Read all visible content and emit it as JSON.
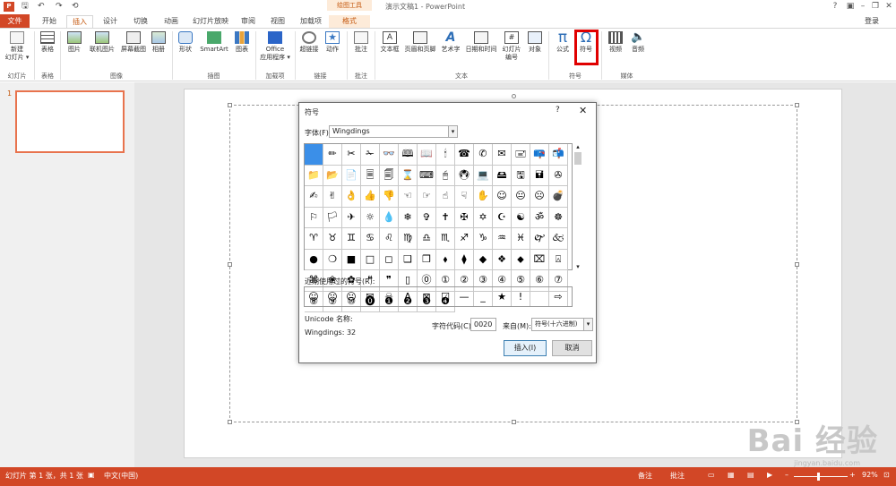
{
  "window": {
    "title": "演示文稿1 - PowerPoint",
    "contextual_tools": "绘图工具",
    "qat": [
      "↶",
      "↷",
      "⟲"
    ],
    "app_icon_label": "P",
    "login": "登录"
  },
  "tabs": [
    "文件",
    "开始",
    "插入",
    "设计",
    "切换",
    "动画",
    "幻灯片放映",
    "审阅",
    "视图",
    "加载项",
    "格式"
  ],
  "ribbon": {
    "groups": {
      "slides": "幻灯片",
      "tables": "表格",
      "images": "图像",
      "illustrations": "插图",
      "addins": "加载项",
      "links": "链接",
      "comments": "批注",
      "text": "文本",
      "symbols": "符号",
      "media": "媒体"
    },
    "buttons": {
      "new_slide": "新建\n幻灯片 ▾",
      "table": "表格",
      "picture": "图片",
      "online_picture": "联机图片",
      "screenshot": "屏幕截图",
      "album": "相册",
      "shapes": "形状",
      "smartart": "SmartArt",
      "chart": "图表",
      "office_apps": "Office\n应用程序 ▾",
      "hyperlink": "超链接",
      "action": "动作",
      "comment": "批注",
      "textbox": "文本框",
      "header_footer": "页眉和页脚",
      "wordart": "艺术字",
      "datetime": "日期和时间",
      "slide_number": "幻灯片\n编号",
      "object": "对象",
      "equation": "公式",
      "symbol": "符号",
      "video": "视频",
      "audio": "音频"
    }
  },
  "thumbnails": {
    "slide_number": "1"
  },
  "watermark": {
    "text": "Bai 经验",
    "url": "jingyan.baidu.com"
  },
  "statusbar": {
    "slide_info": "幻灯片 第 1 张，共 1 张",
    "language": "中文(中国)",
    "notes": "备注",
    "comments": "批注",
    "zoom": "92%"
  },
  "dialog": {
    "title": "符号",
    "help": "?",
    "close": "✕",
    "font_label": "字体(F):",
    "font_value": "Wingdings",
    "symbols": [
      " ",
      "✏",
      "✂",
      "✁",
      "👓",
      "🕮",
      "📖",
      "🕯",
      "☎",
      "✆",
      "✉",
      "🖃",
      "📪",
      "📬",
      "📁",
      "📂",
      "📄",
      "🗏",
      "🗐",
      "⌛",
      "⌨",
      "🖰",
      "🖲",
      "💻",
      "🖴",
      "🖫",
      "🖬",
      "✇",
      "✍",
      "✌",
      "👌",
      "👍",
      "👎",
      "☜",
      "☞",
      "☝",
      "☟",
      "✋",
      "☺",
      "😐",
      "☹",
      "💣",
      "⚐",
      "🏳",
      "✈",
      "☼",
      "💧",
      "❄",
      "✞",
      "✝",
      "✠",
      "✡",
      "☪",
      "☯",
      "ॐ",
      "☸",
      "♈",
      "♉",
      "♊",
      "♋",
      "♌",
      "♍",
      "♎",
      "♏",
      "♐",
      "♑",
      "♒",
      "♓",
      "🙰",
      "🙵",
      "●",
      "❍",
      "■",
      "□",
      "◻",
      "❑",
      "❒",
      "⬧",
      "⧫",
      "◆",
      "❖",
      "⬥",
      "⌧",
      "⍓",
      "⌘",
      "❀",
      "✿",
      "❝",
      "❞",
      "▯",
      "⓪",
      "①",
      "②",
      "③",
      "④",
      "⑤",
      "⑥",
      "⑦",
      "⑧",
      "⑨",
      "⑩",
      "⓿",
      "❶",
      "❷",
      "❸",
      "❹"
    ],
    "recent_label": "近期使用过的符号(R):",
    "recent": [
      "☺",
      "☹",
      "😐",
      "✉",
      "☠",
      "A",
      "⊠",
      "☑",
      "—",
      "_",
      "★",
      "!",
      " ",
      "⇨"
    ],
    "unicode_label": "Unicode 名称:",
    "wingdings_code": "Wingdings: 32",
    "charcode_label": "字符代码(C):",
    "charcode_value": "0020",
    "from_label": "来自(M):",
    "from_value": "符号(十六进制)",
    "insert": "插入(I)",
    "cancel": "取消"
  }
}
